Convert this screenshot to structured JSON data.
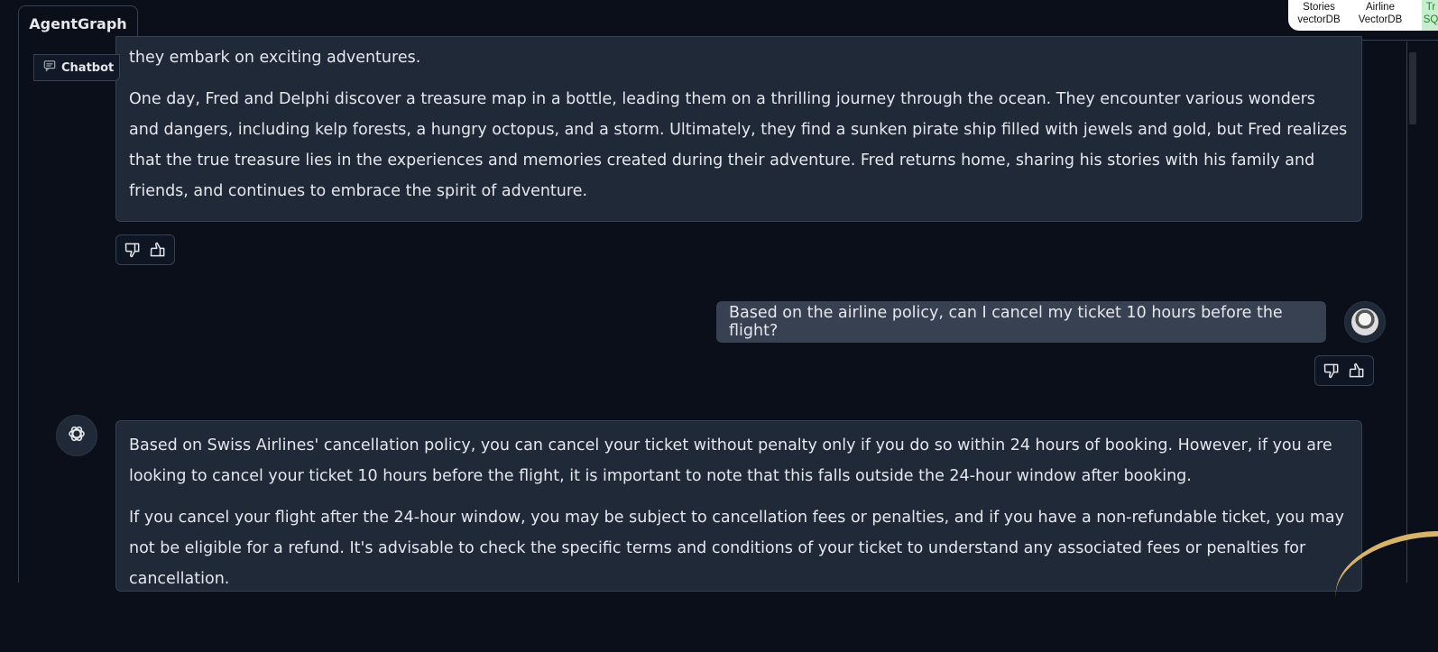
{
  "tabs": [
    {
      "label": "AgentGraph",
      "active": true
    }
  ],
  "legend": [
    {
      "line1": "Stories",
      "line2": "vectorDB"
    },
    {
      "line1": "Airline",
      "line2": "VectorDB"
    },
    {
      "line1": "Tr",
      "line2": "SQ"
    }
  ],
  "chatbot": {
    "label": "Chatbot",
    "messages": [
      {
        "role": "assistant",
        "paragraphs": [
          "they embark on exciting adventures.",
          "One day, Fred and Delphi discover a treasure map in a bottle, leading them on a thrilling journey through the ocean. They encounter various wonders and dangers, including kelp forests, a hungry octopus, and a storm. Ultimately, they find a sunken pirate ship filled with jewels and gold, but Fred realizes that the true treasure lies in the experiences and memories created during their adventure. Fred returns home, sharing his stories with his family and friends, and continues to embrace the spirit of adventure."
        ]
      },
      {
        "role": "user",
        "text": "Based on the airline policy, can I cancel my ticket 10 hours before the flight?"
      },
      {
        "role": "assistant",
        "paragraphs": [
          "Based on Swiss Airlines' cancellation policy, you can cancel your ticket without penalty only if you do so within 24 hours of booking. However, if you are looking to cancel your ticket 10 hours before the flight, it is important to note that this falls outside the 24-hour window after booking.",
          "If you cancel your flight after the 24-hour window, you may be subject to cancellation fees or penalties, and if you have a non-refundable ticket, you may not be eligible for a refund. It's advisable to check the specific terms and conditions of your ticket to understand any associated fees or penalties for cancellation."
        ]
      }
    ]
  },
  "icons": {
    "chatbot": "chat-bubble-icon",
    "dislike": "thumbs-down-icon",
    "like": "thumbs-up-icon",
    "bot_avatar": "openai-logo-icon",
    "user_avatar": "user-avatar"
  }
}
